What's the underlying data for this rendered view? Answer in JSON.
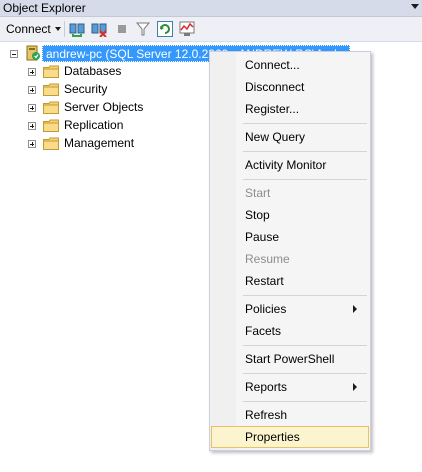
{
  "panel": {
    "title": "Object Explorer"
  },
  "toolbar": {
    "connect_label": "Connect"
  },
  "tree": {
    "server_label": "andrew-pc (SQL Server 12.0.2269 - ANDREW-PC\\Andrew)",
    "children": [
      "Databases",
      "Security",
      "Server Objects",
      "Replication",
      "Management"
    ]
  },
  "context_menu": {
    "items": [
      {
        "label": "Connect...",
        "state": "enabled"
      },
      {
        "label": "Disconnect",
        "state": "enabled"
      },
      {
        "label": "Register...",
        "state": "enabled"
      },
      {
        "label": "New Query",
        "state": "enabled"
      },
      {
        "label": "Activity Monitor",
        "state": "enabled"
      },
      {
        "label": "Start",
        "state": "disabled"
      },
      {
        "label": "Stop",
        "state": "enabled"
      },
      {
        "label": "Pause",
        "state": "enabled"
      },
      {
        "label": "Resume",
        "state": "disabled"
      },
      {
        "label": "Restart",
        "state": "enabled"
      },
      {
        "label": "Policies",
        "state": "enabled",
        "submenu": true
      },
      {
        "label": "Facets",
        "state": "enabled"
      },
      {
        "label": "Start PowerShell",
        "state": "enabled"
      },
      {
        "label": "Reports",
        "state": "enabled",
        "submenu": true
      },
      {
        "label": "Refresh",
        "state": "enabled"
      },
      {
        "label": "Properties",
        "state": "highlighted"
      }
    ]
  },
  "colors": {
    "selection": "#3399ff",
    "menu_highlight": "#fcf4cf",
    "menu_highlight_border": "#e5c365",
    "title_bar": "#d6dbe9"
  }
}
